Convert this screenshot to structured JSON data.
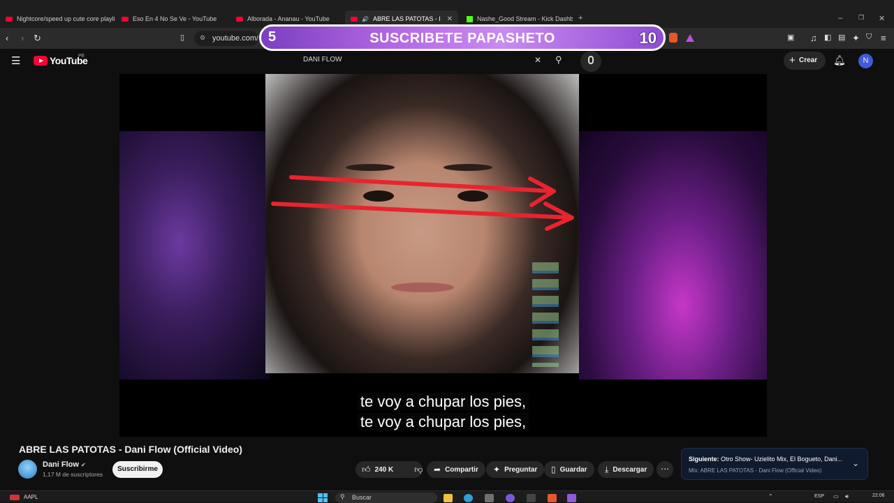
{
  "browser": {
    "tabs": [
      {
        "title": "Nightcore/speed up cute core playlis",
        "favicon": "youtube-icon"
      },
      {
        "title": "Eso En 4 No Se Ve - YouTube",
        "favicon": "youtube-icon"
      },
      {
        "title": "Alborada - Ananau - YouTube",
        "favicon": "youtube-icon"
      },
      {
        "title": "ABRE LAS PATOTAS - Dani Fl",
        "favicon": "youtube-icon",
        "active": true
      },
      {
        "title": "Nashe_Good Stream - Kick Dashboar",
        "favicon": "kick-icon"
      }
    ],
    "url": "youtube.com/w"
  },
  "overlay": {
    "left_count": "5",
    "text": "SUSCRIBETE PAPASHETO",
    "right_count": "10"
  },
  "youtube_header": {
    "logo_text": "YouTube",
    "region": "PE",
    "search_partial": "DANI FLOW",
    "create_label": "Crear",
    "avatar_letter": "N"
  },
  "video": {
    "subtitle_line1": "te voy a chupar los pies,",
    "subtitle_line2": "te voy a chupar los pies,"
  },
  "info": {
    "title": "ABRE LAS PATOTAS - Dani Flow (Official Video)",
    "channel_name": "Dani Flow",
    "subscribers": "1,17 M de suscriptores",
    "subscribe_label": "Suscribirme",
    "likes": "240 K",
    "share_label": "Compartir",
    "ask_label": "Preguntar",
    "save_label": "Guardar",
    "download_label": "Descargar"
  },
  "up_next": {
    "label": "Siguiente:",
    "value": "Otro Show- Uzielito Mix, El Bogueto, Dani...",
    "mix": "Mix: ABRE LAS PATOTAS - Dani Flow (Official Video)"
  },
  "taskbar": {
    "stock": "AAPL",
    "search_placeholder": "Buscar",
    "language": "ESP",
    "time": "22:06"
  },
  "colors": {
    "youtube_red": "#ff0033",
    "banner_purple": "#b76ae6",
    "background": "#0f0f0f"
  }
}
